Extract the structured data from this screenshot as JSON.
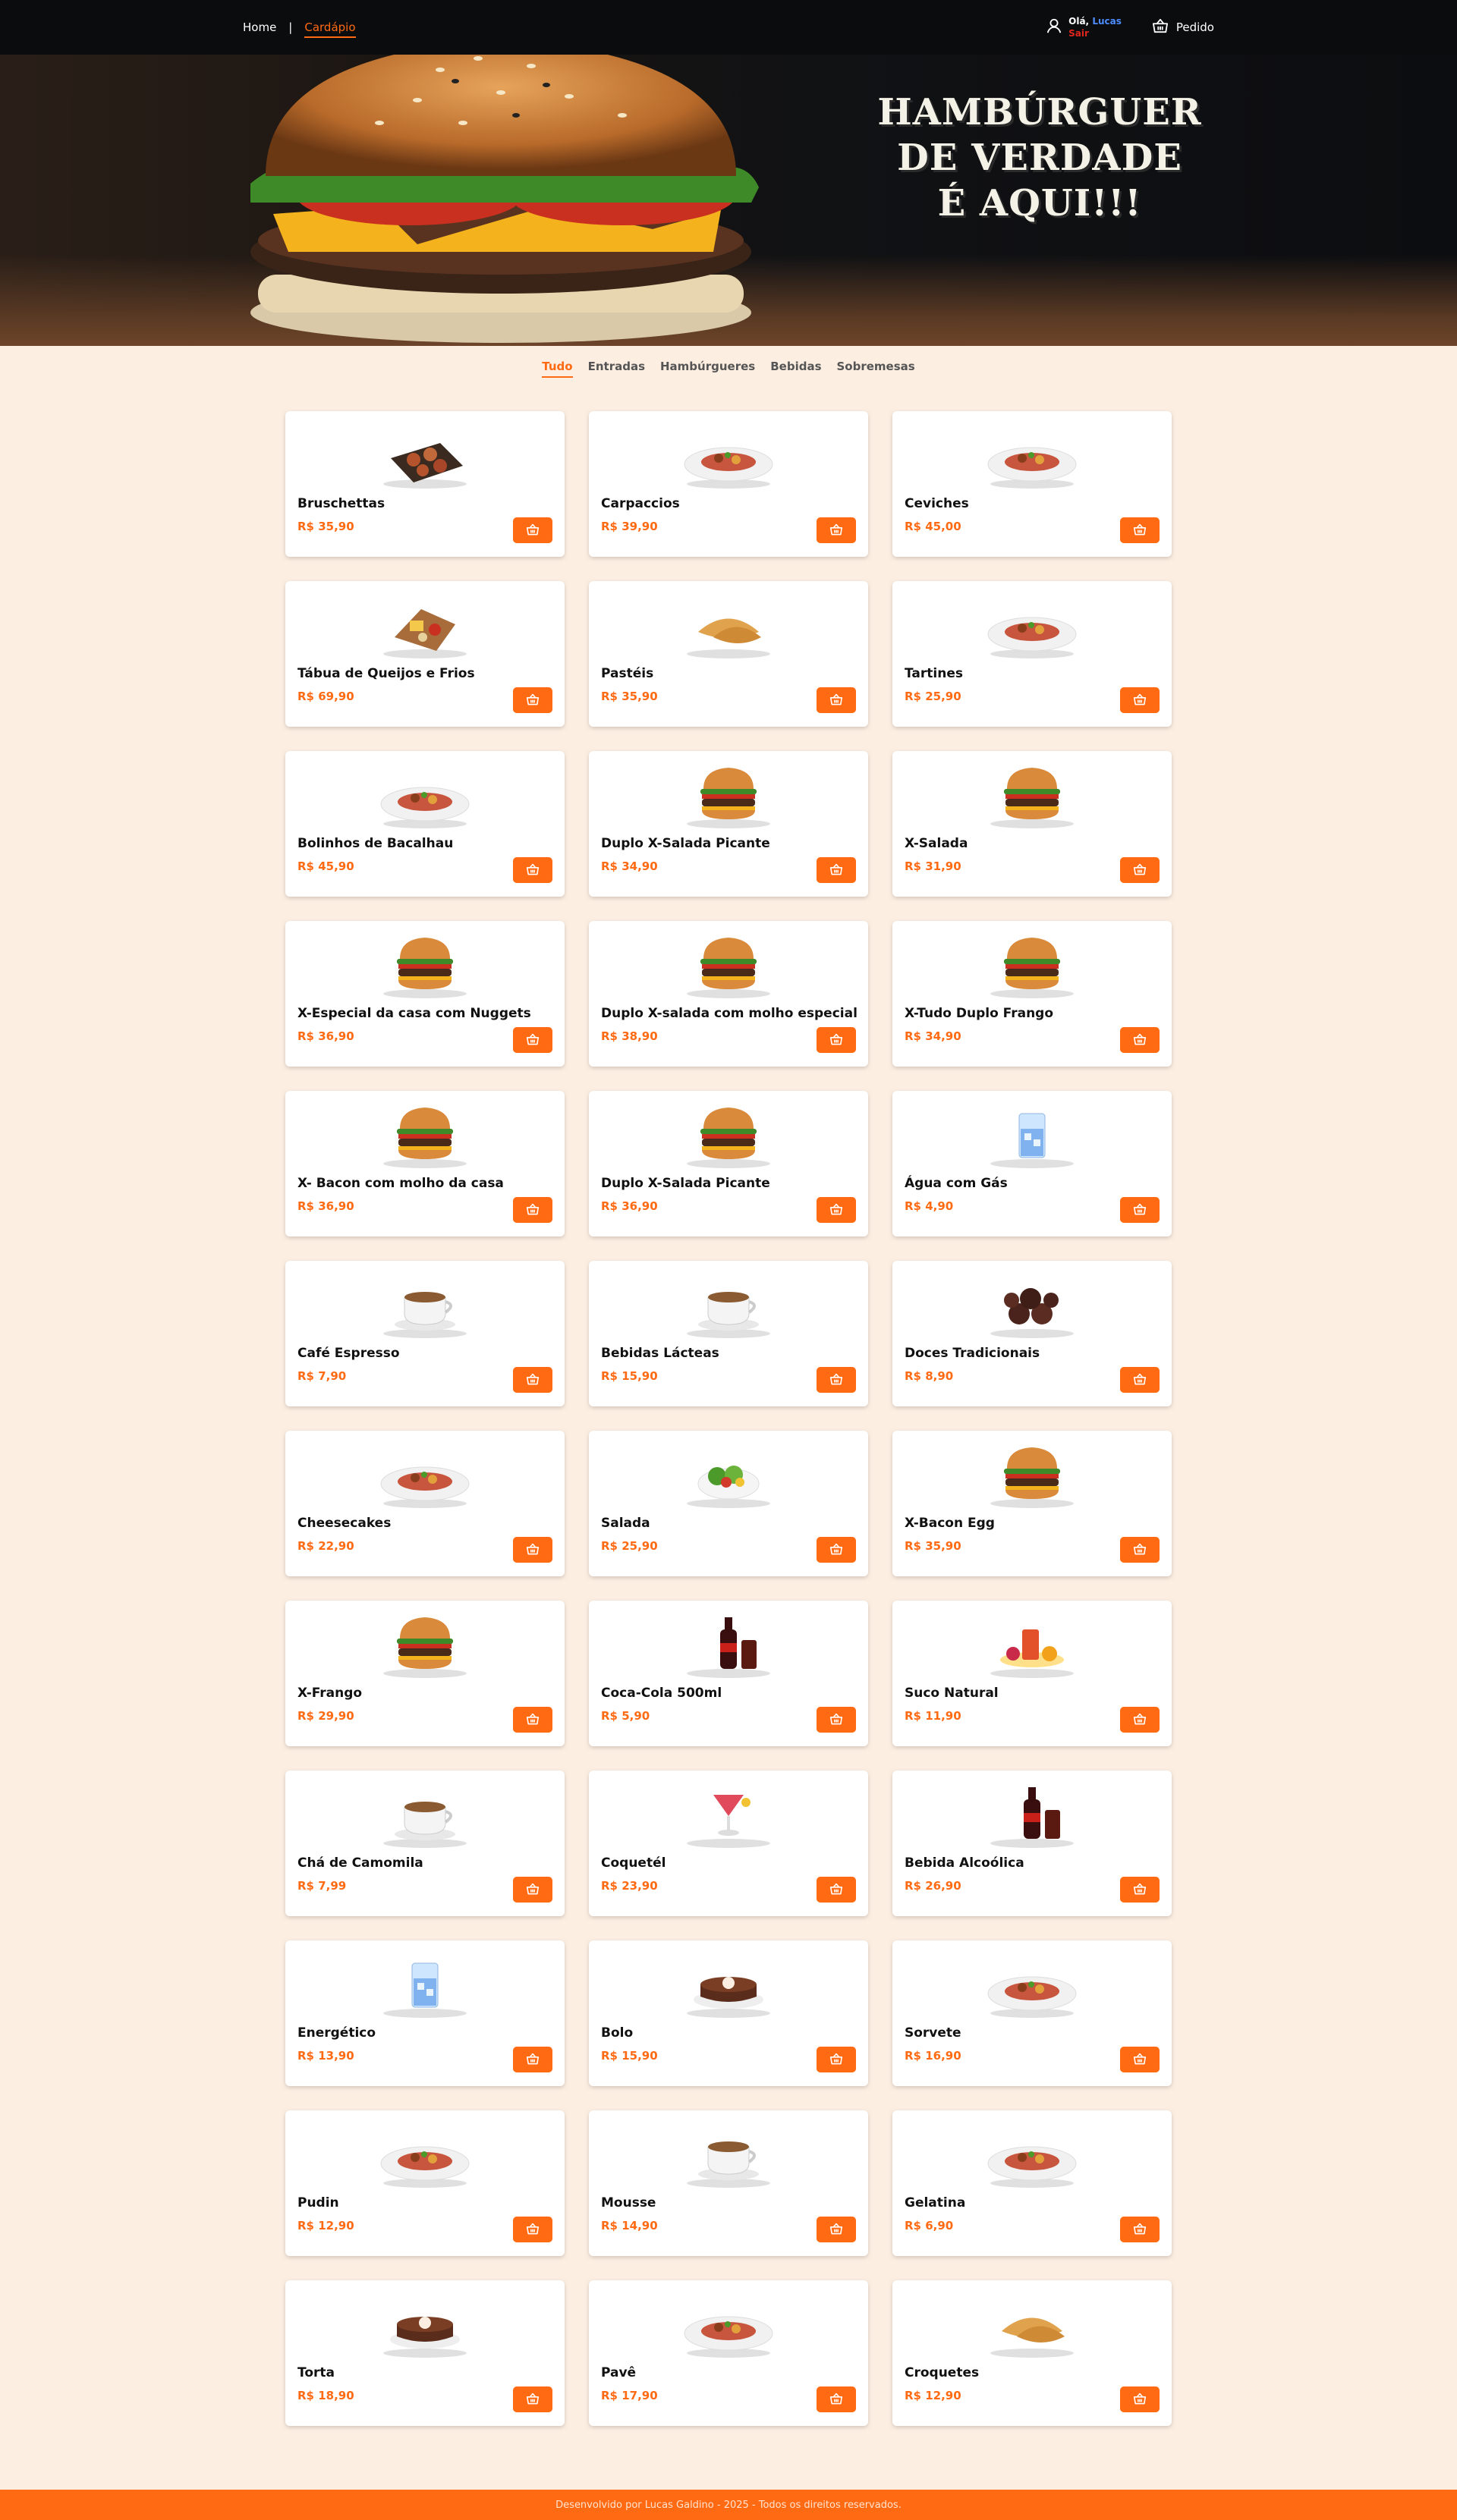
{
  "nav": {
    "home": "Home",
    "separator": "|",
    "menu": "Cardápio",
    "greeting": "Olá,",
    "user_name": "Lucas",
    "logout": "Sair",
    "order": "Pedido"
  },
  "hero": {
    "line1": "HAMBÚRGUER",
    "line2": "DE VERDADE",
    "line3": "É AQUI!!!"
  },
  "tabs": [
    "Tudo",
    "Entradas",
    "Hambúrgueres",
    "Bebidas",
    "Sobremesas"
  ],
  "active_tab": "Tudo",
  "products": [
    {
      "name": "Bruschettas",
      "price": "R$ 35,90",
      "icon": "bruschetta"
    },
    {
      "name": "Carpaccios",
      "price": "R$ 39,90",
      "icon": "plate"
    },
    {
      "name": "Ceviches",
      "price": "R$ 45,00",
      "icon": "plate"
    },
    {
      "name": "Tábua de Queijos e Frios",
      "price": "R$ 69,90",
      "icon": "board"
    },
    {
      "name": "Pastéis",
      "price": "R$ 35,90",
      "icon": "pastry"
    },
    {
      "name": "Tartines",
      "price": "R$ 25,90",
      "icon": "plate"
    },
    {
      "name": "Bolinhos de Bacalhau",
      "price": "R$ 45,90",
      "icon": "plate"
    },
    {
      "name": "Duplo X-Salada Picante",
      "price": "R$ 34,90",
      "icon": "burger"
    },
    {
      "name": "X-Salada",
      "price": "R$ 31,90",
      "icon": "burger"
    },
    {
      "name": "X-Especial da casa com Nuggets",
      "price": "R$ 36,90",
      "icon": "burger"
    },
    {
      "name": "Duplo X-salada com molho especial",
      "price": "R$ 38,90",
      "icon": "burger"
    },
    {
      "name": "X-Tudo Duplo Frango",
      "price": "R$ 34,90",
      "icon": "burger"
    },
    {
      "name": "X- Bacon com molho da casa",
      "price": "R$ 36,90",
      "icon": "burger"
    },
    {
      "name": "Duplo X-Salada Picante",
      "price": "R$ 36,90",
      "icon": "burger"
    },
    {
      "name": "Água com Gás",
      "price": "R$ 4,90",
      "icon": "glass"
    },
    {
      "name": "Café Espresso",
      "price": "R$ 7,90",
      "icon": "cup"
    },
    {
      "name": "Bebidas Lácteas",
      "price": "R$ 15,90",
      "icon": "cup"
    },
    {
      "name": "Doces Tradicionais",
      "price": "R$ 8,90",
      "icon": "sweets"
    },
    {
      "name": "Cheesecakes",
      "price": "R$ 22,90",
      "icon": "plate"
    },
    {
      "name": "Salada",
      "price": "R$ 25,90",
      "icon": "salad"
    },
    {
      "name": "X-Bacon Egg",
      "price": "R$ 35,90",
      "icon": "burger"
    },
    {
      "name": "X-Frango",
      "price": "R$ 29,90",
      "icon": "burger"
    },
    {
      "name": "Coca-Cola 500ml",
      "price": "R$ 5,90",
      "icon": "bottle"
    },
    {
      "name": "Suco Natural",
      "price": "R$ 11,90",
      "icon": "juice"
    },
    {
      "name": "Chá de Camomila",
      "price": "R$ 7,99",
      "icon": "cup"
    },
    {
      "name": "Coquetél",
      "price": "R$ 23,90",
      "icon": "cocktail"
    },
    {
      "name": "Bebida Alcoólica",
      "price": "R$ 26,90",
      "icon": "bottle"
    },
    {
      "name": "Energético",
      "price": "R$ 13,90",
      "icon": "glass"
    },
    {
      "name": "Bolo",
      "price": "R$ 15,90",
      "icon": "cake"
    },
    {
      "name": "Sorvete",
      "price": "R$ 16,90",
      "icon": "plate"
    },
    {
      "name": "Pudin",
      "price": "R$ 12,90",
      "icon": "plate"
    },
    {
      "name": "Mousse",
      "price": "R$ 14,90",
      "icon": "cup"
    },
    {
      "name": "Gelatina",
      "price": "R$ 6,90",
      "icon": "plate"
    },
    {
      "name": "Torta",
      "price": "R$ 18,90",
      "icon": "cake"
    },
    {
      "name": "Pavê",
      "price": "R$ 17,90",
      "icon": "plate"
    },
    {
      "name": "Croquetes",
      "price": "R$ 12,90",
      "icon": "pastry"
    }
  ],
  "footer": "Desenvolvido por Lucas Galdino - 2025 - Todos os direitos reservados.",
  "colors": {
    "accent": "#ff6a13",
    "nav_bg": "#0b0c0e",
    "page_bg": "#fdeee2",
    "user_name": "#4d8cff",
    "logout": "#e0261c"
  }
}
